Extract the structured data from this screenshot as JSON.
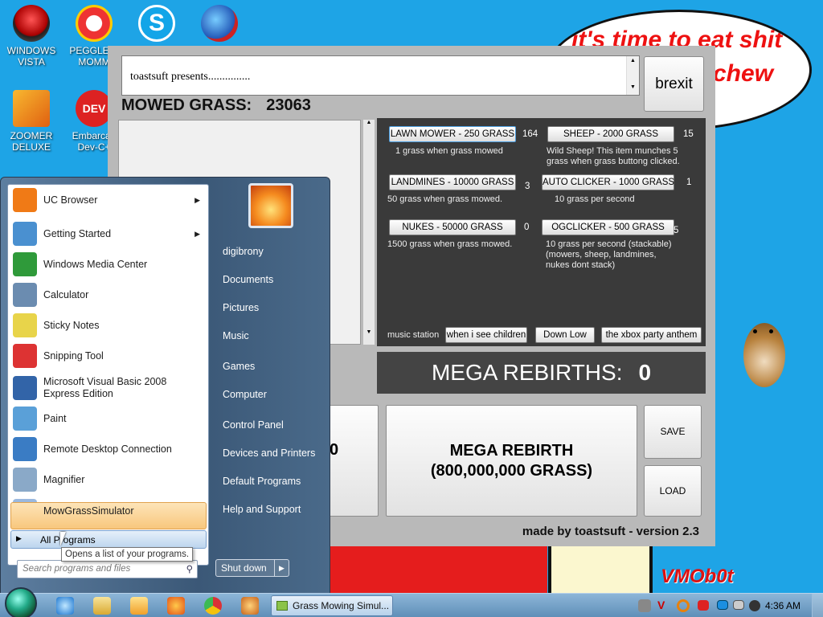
{
  "desktop": {
    "icons": [
      {
        "label": "WINDOWS\nVISTA",
        "icon": "vista-icon"
      },
      {
        "label": "PEGGLE N\nMOMM",
        "icon": "peggle-icon"
      },
      {
        "label": "",
        "icon": "skype-icon"
      },
      {
        "label": "",
        "icon": "browser-globe-icon"
      },
      {
        "label": "ZOOMER\nDELUXE",
        "icon": "zoomer-icon"
      },
      {
        "label": "Embarcad\nDev-C+",
        "icon": "devcpp-icon"
      }
    ],
    "speech_line1": "it's time to eat shit",
    "speech_line2": "chew",
    "watermark": "VMOb0t"
  },
  "app": {
    "log_text": "toastsuft presents...............",
    "brexit_label": "brexit",
    "mowed_label": "MOWED GRASS:",
    "mowed_value": "23063",
    "shop": [
      {
        "btn": "LAWN MOWER - 250 GRASS",
        "count": "164",
        "desc": "1 grass when grass mowed"
      },
      {
        "btn": "SHEEP - 2000 GRASS",
        "count": "15",
        "desc": "Wild Sheep! This item munches 5 grass when grass buttong clicked."
      },
      {
        "btn": "LANDMINES - 10000 GRASS",
        "count": "3",
        "desc": "50 grass when grass mowed."
      },
      {
        "btn": "AUTO CLICKER - 1000 GRASS",
        "count": "1",
        "desc": "10 grass per second"
      },
      {
        "btn": "NUKES - 50000 GRASS",
        "count": "0",
        "desc": "1500 grass when grass mowed."
      },
      {
        "btn": "OGCLICKER - 500 GRASS",
        "count": "5",
        "desc": "10 grass per second (stackable) (mowers, sheep, landmines, nukes dont stack)"
      }
    ],
    "music_label": "music station",
    "music": [
      "when i see children",
      "Down Low",
      "the xbox party anthem"
    ],
    "mega_label": "MEGA REBIRTHS:",
    "mega_value": "0",
    "partial_value": "0",
    "mega_btn_line1": "MEGA REBIRTH",
    "mega_btn_line2": "(800,000,000 GRASS)",
    "save_label": "SAVE",
    "load_label": "LOAD",
    "footer": "made by toastsuft - version 2.3"
  },
  "start_menu": {
    "left_items": [
      {
        "label": "UC Browser",
        "icon": "uc-browser-icon",
        "arrow": true,
        "color": "#f07a16"
      },
      {
        "label": "Getting Started",
        "icon": "getting-started-icon",
        "arrow": true,
        "color": "#4a90d0"
      },
      {
        "label": "Windows Media Center",
        "icon": "media-center-icon",
        "arrow": false,
        "color": "#2f9a3a"
      },
      {
        "label": "Calculator",
        "icon": "calculator-icon",
        "arrow": false,
        "color": "#6b8cb0"
      },
      {
        "label": "Sticky Notes",
        "icon": "sticky-notes-icon",
        "arrow": false,
        "color": "#e8d44a"
      },
      {
        "label": "Snipping Tool",
        "icon": "snipping-tool-icon",
        "arrow": false,
        "color": "#d33"
      },
      {
        "label": "Microsoft Visual Basic 2008\nExpress Edition",
        "icon": "visual-basic-icon",
        "arrow": false,
        "color": "#3264a8"
      },
      {
        "label": "Paint",
        "icon": "paint-icon",
        "arrow": false,
        "color": "#5aa0d8"
      },
      {
        "label": "Remote Desktop Connection",
        "icon": "remote-desktop-icon",
        "arrow": false,
        "color": "#3a7cc4"
      },
      {
        "label": "Magnifier",
        "icon": "magnifier-icon",
        "arrow": false,
        "color": "#8aa9c8"
      },
      {
        "label": "MowGrassSimulator",
        "icon": "app-window-icon",
        "arrow": false,
        "color": "#9ab8de"
      }
    ],
    "all_programs": "All Programs",
    "tooltip": "Opens a list of your programs.",
    "search_placeholder": "Search programs and files",
    "right_items": [
      "digibrony",
      "Documents",
      "Pictures",
      "Music",
      "Games",
      "Computer",
      "Control Panel",
      "Devices and Printers",
      "Default Programs",
      "Help and Support"
    ],
    "shutdown": "Shut down"
  },
  "taskbar": {
    "task_label": "Grass Mowing Simul...",
    "clock": "4:36 AM"
  }
}
